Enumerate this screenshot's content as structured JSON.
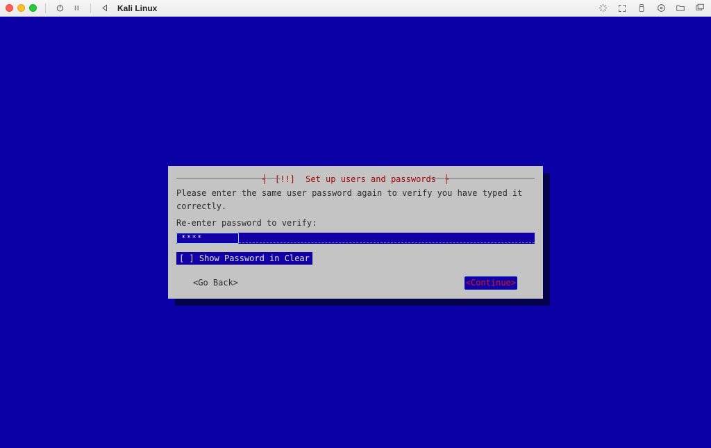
{
  "titlebar": {
    "vm_name": "Kali Linux",
    "icons": {
      "power": "power-icon",
      "pause": "pause-icon",
      "back": "back-triangle-icon",
      "right": {
        "loading": "spinner-icon",
        "expand": "expand-icon",
        "usb": "usb-icon",
        "disc": "disc-icon",
        "folder": "folder-icon",
        "windows": "windows-icon"
      }
    }
  },
  "colors": {
    "guest_bg": "#0b00a6",
    "dialog_bg": "#c4c4c4",
    "accent_red": "#a30000",
    "field_blue": "#1200a6"
  },
  "dialog": {
    "title_bracket_left": "┤",
    "title_prefix": "[!!]",
    "title_text": "Set up users and passwords",
    "title_bracket_right": "├",
    "instruction": "Please enter the same user password again to verify you have typed it correctly.",
    "field_label": "Re-enter password to verify:",
    "password_masked": "****",
    "show_clear_checkbox": "[ ]",
    "show_clear_label": "Show Password in Clear",
    "go_back": "<Go Back>",
    "continue": "<Continue>"
  }
}
